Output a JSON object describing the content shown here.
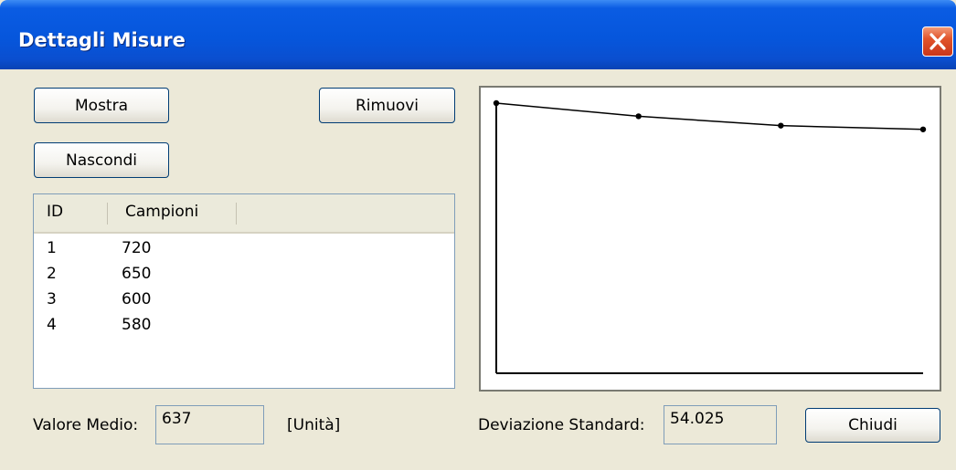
{
  "window": {
    "title": "Dettagli Misure"
  },
  "buttons": {
    "show": "Mostra",
    "hide": "Nascondi",
    "remove": "Rimuovi",
    "close": "Chiudi"
  },
  "table": {
    "columns": [
      "ID",
      "Campioni"
    ],
    "rows": [
      [
        "1",
        "720"
      ],
      [
        "2",
        "650"
      ],
      [
        "3",
        "600"
      ],
      [
        "4",
        "580"
      ]
    ]
  },
  "stats": {
    "mean_label": "Valore Medio:",
    "mean_value": "637",
    "unit_label": "[Unità]",
    "std_label": "Deviazione Standard:",
    "std_value": "54.025"
  },
  "chart_data": {
    "type": "line",
    "x": [
      1,
      2,
      3,
      4
    ],
    "series": [
      {
        "values": [
          720,
          650,
          600,
          580
        ]
      }
    ],
    "title": "",
    "xlabel": "",
    "ylabel": "",
    "ylim": [
      0,
      720
    ],
    "grid": false,
    "line_color": "#000000"
  },
  "colors": {
    "titlebar": "#0656dc",
    "window_bg": "#ece9d8",
    "close_button": "#e1542b",
    "button_border": "#003c74"
  }
}
